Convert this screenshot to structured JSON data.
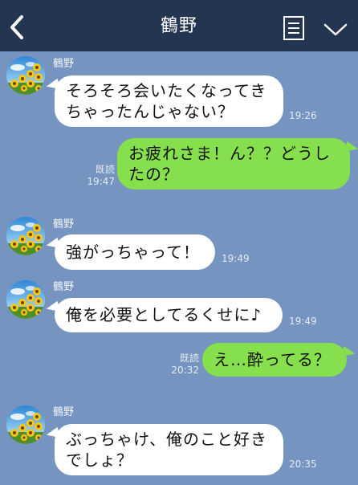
{
  "header": {
    "title": "鶴野",
    "back_icon": "chevron-left-icon",
    "menu_icon": "list-icon",
    "expand_icon": "chevron-down-icon"
  },
  "messages": [
    {
      "type": "incoming",
      "sender": "鶴野",
      "lines": [
        "そろそろ会いたくなってき",
        "ちゃったんじゃない？"
      ],
      "time": "19:26"
    },
    {
      "type": "outgoing",
      "lines": [
        "お疲れさま！ん？？どうし",
        "たの？"
      ],
      "read": "既読",
      "time": "19:47"
    },
    {
      "type": "incoming",
      "sender": "鶴野",
      "lines": [
        "強がっちゃって！"
      ],
      "time": "19:49"
    },
    {
      "type": "incoming",
      "sender": "鶴野",
      "lines": [
        "俺を必要としてるくせに♪"
      ],
      "time": "19:49"
    },
    {
      "type": "outgoing",
      "lines": [
        "え…酔ってる？"
      ],
      "read": "既読",
      "time": "20:32"
    },
    {
      "type": "incoming",
      "sender": "鶴野",
      "lines": [
        "ぶっちゃけ、俺のこと好き",
        "でしょ？"
      ],
      "time": "20:35"
    }
  ],
  "avatar_icon": "sunflower-avatar",
  "colors": {
    "header_bg": "#243552",
    "chat_bg": "#7594bf",
    "incoming_bubble": "#ffffff",
    "outgoing_bubble": "#86df4c",
    "header_text": "#ffffff"
  }
}
